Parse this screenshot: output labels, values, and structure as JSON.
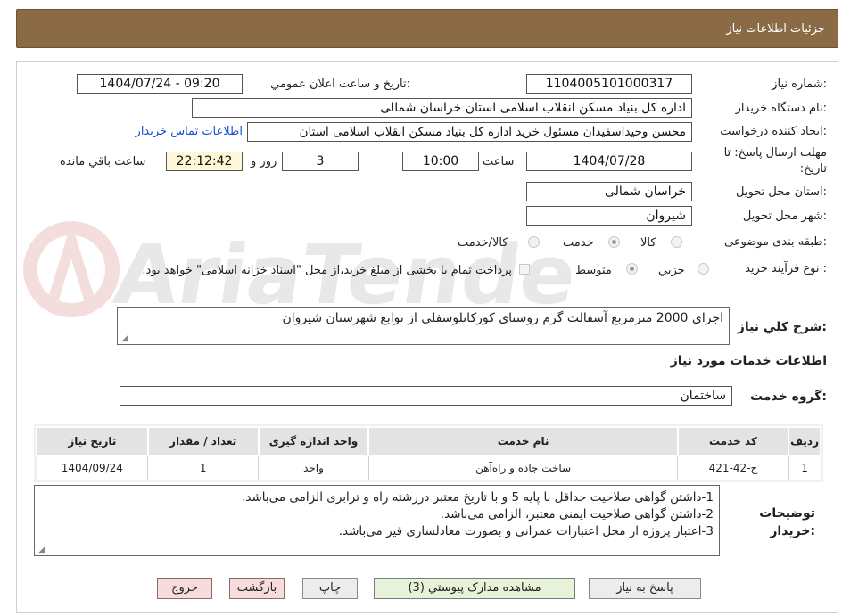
{
  "header": {
    "title": "جزئیات اطلاعات نیاز"
  },
  "fields": {
    "need_number_label": "شماره نیاز:",
    "need_number": "1104005101000317",
    "announce_label": "تاریخ و ساعت اعلان عمومي:",
    "announce_value": "1404/07/24 - 09:20",
    "buyer_org_label": "نام دستگاه خریدار:",
    "buyer_org": "اداره کل بنیاد مسکن انقلاب اسلامی استان خراسان شمالی",
    "requester_label": "ایجاد کننده درخواست:",
    "requester": "محسن وحیداسفیدان مسئول خرید اداره کل بنیاد مسکن انقلاب اسلامی استان",
    "buyer_contact_link": "اطلاعات تماس خریدار",
    "deadline_label": "مهلت ارسال پاسخ: تا تاریخ:",
    "deadline_date": "1404/07/28",
    "time_label": "ساعت",
    "deadline_time": "10:00",
    "days_value": "3",
    "days_label": "روز و",
    "remaining_time": "22:12:42",
    "remaining_label": "ساعت باقي مانده",
    "province_label": "استان محل تحویل:",
    "province": "خراسان شمالی",
    "city_label": "شهر محل تحویل:",
    "city": "شیروان",
    "category_label": "طبقه بندی موضوعی:",
    "category_options": [
      "کالا",
      "خدمت",
      "کالا/خدمت"
    ],
    "process_label": "نوع فرآیند خرید :",
    "process_options": [
      "جزيي",
      "متوسط"
    ],
    "payment_note": "پرداخت تمام یا بخشی از مبلغ خرید،از محل \"اسناد خزانه اسلامی\" خواهد بود.",
    "description_label": "شرح کلي نیاز:",
    "description": "اجرای 2000 مترمربع آسفالت گرم روستای کورکانلوسفلی از توابع شهرستان شیروان"
  },
  "services": {
    "section_title": "اطلاعات خدمات مورد نیاز",
    "group_label": "گروه خدمت:",
    "group_value": "ساختمان",
    "columns": [
      "ردیف",
      "کد خدمت",
      "نام خدمت",
      "واحد اندازه گیری",
      "تعداد / مقدار",
      "تاریخ نیاز"
    ],
    "rows": [
      [
        "1",
        "ج-42-421",
        "ساخت جاده و راه‌آهن",
        "واحد",
        "1",
        "1404/09/24"
      ]
    ]
  },
  "notes": {
    "label": "توضیحات خریدار:",
    "lines": [
      "1-داشتن گواهی صلاحیت حداقل با پایه 5 و با تاریخ معتبر دررشته راه و ترابری الزامی می‌باشد.",
      "2-داشتن گواهی صلاحیت ایمنی معتبر، الزامی می‌باشد.",
      "3-اعتبار پروژه از محل اعتبارات عمرانی و بصورت معادلسازی قیر می‌باشد."
    ]
  },
  "buttons": {
    "respond": "پاسخ به نیاز",
    "attachments": "مشاهده مدارک پیوستي (3)",
    "print": "چاپ",
    "back": "بازگشت",
    "exit": "خروج"
  },
  "watermark": {
    "text": "AriaTender.neT"
  },
  "colors": {
    "header_bg": "#8b6b45",
    "link": "#1a4fd6",
    "remaining_bg": "#fff8d8",
    "attachments_bg": "#e6f3d9",
    "exit_bg": "#f7dcdc"
  }
}
